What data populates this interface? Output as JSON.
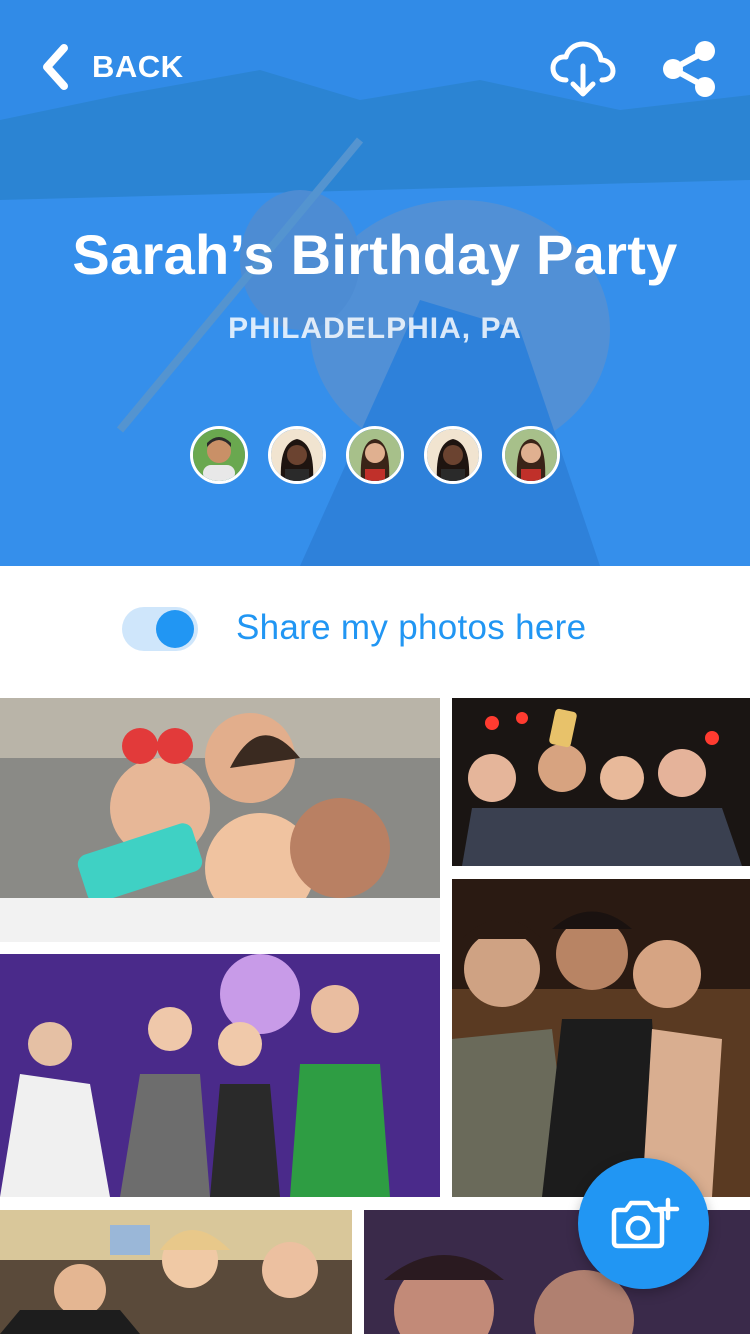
{
  "header": {
    "back_label": "BACK",
    "download_icon": "cloud-download-icon",
    "share_icon": "share-icon"
  },
  "event": {
    "title": "Sarah’s Birthday Party",
    "location": "PHILADELPHIA, PA"
  },
  "attendees": [
    {
      "icon": "avatar-1"
    },
    {
      "icon": "avatar-2"
    },
    {
      "icon": "avatar-3"
    },
    {
      "icon": "avatar-4"
    },
    {
      "icon": "avatar-5"
    }
  ],
  "share_toggle": {
    "label": "Share my photos here",
    "on": true
  },
  "photos": [
    {
      "icon": "party-selfie-photo"
    },
    {
      "icon": "group-selfie-photo"
    },
    {
      "icon": "dance-party-photo"
    },
    {
      "icon": "friends-night-photo"
    },
    {
      "icon": "bar-group-photo"
    },
    {
      "icon": "night-selfie-photo"
    }
  ],
  "fab": {
    "icon": "add-photo-camera-icon"
  },
  "colors": {
    "accent": "#2196f3",
    "hero_overlay": "#2a8af0",
    "toggle_track": "#cfe6fb"
  }
}
